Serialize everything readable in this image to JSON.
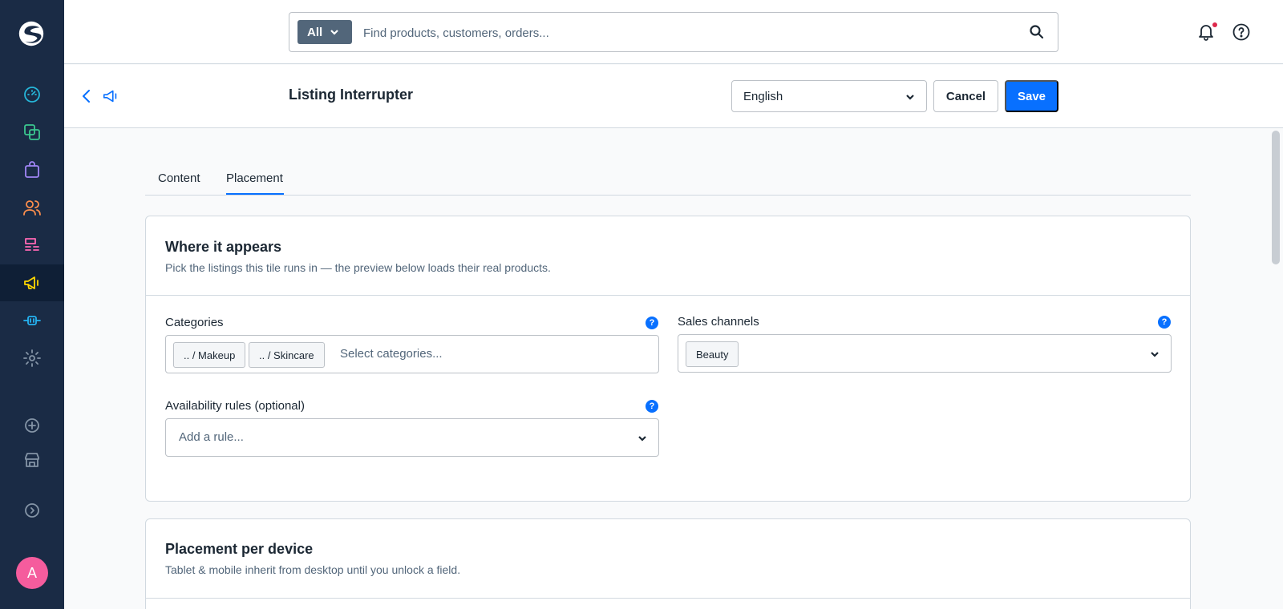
{
  "sidebar": {
    "items": [
      {
        "name": "dashboard",
        "color": "#26b6d9"
      },
      {
        "name": "catalogues",
        "color": "#3bc78f"
      },
      {
        "name": "orders",
        "color": "#a085f5"
      },
      {
        "name": "customers",
        "color": "#ff8f4d"
      },
      {
        "name": "content",
        "color": "#ff68b4"
      },
      {
        "name": "marketing",
        "color": "#ffd700",
        "active": true
      },
      {
        "name": "extensions",
        "color": "#25b3f2"
      },
      {
        "name": "settings",
        "color": "#8494a6"
      }
    ],
    "avatar_initial": "A"
  },
  "topbar": {
    "search_scope": "All",
    "search_placeholder": "Find products, customers, orders..."
  },
  "smartbar": {
    "title": "Listing Interrupter",
    "language": "English",
    "cancel_label": "Cancel",
    "save_label": "Save"
  },
  "tabs": [
    {
      "label": "Content",
      "active": false
    },
    {
      "label": "Placement",
      "active": true
    }
  ],
  "where_card": {
    "title": "Where it appears",
    "subtitle": "Pick the listings this tile runs in — the preview below loads their real products.",
    "categories": {
      "label": "Categories",
      "chips": [
        ".. / Makeup",
        ".. / Skincare"
      ],
      "placeholder": "Select categories..."
    },
    "sales_channels": {
      "label": "Sales channels",
      "chips": [
        "Beauty"
      ]
    },
    "availability": {
      "label": "Availability rules (optional)",
      "placeholder": "Add a rule..."
    },
    "help_glyph": "?"
  },
  "device_card": {
    "title": "Placement per device",
    "subtitle": "Tablet & mobile inherit from desktop until you unlock a field."
  },
  "colors": {
    "accent": "#0870ff",
    "sidebar_bg": "#1a2b45",
    "notification_dot": "#de294c",
    "avatar": "#f55c9d"
  }
}
